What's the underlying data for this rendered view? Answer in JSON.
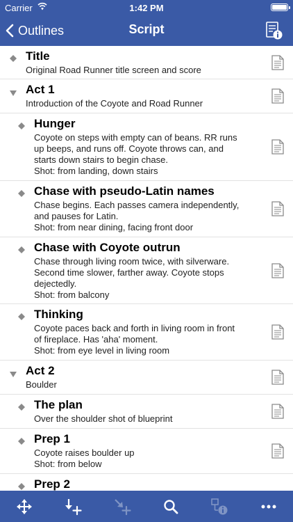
{
  "status_bar": {
    "carrier": "Carrier",
    "time": "1:42 PM"
  },
  "nav": {
    "back_label": "Outlines",
    "title": "Script"
  },
  "rows": [
    {
      "title": "Title",
      "desc": "Original Road Runner title screen and score"
    },
    {
      "title": "Act 1",
      "desc": "Introduction of the Coyote and Road Runner"
    },
    {
      "title": "Hunger",
      "desc": "Coyote on steps with empty can of beans. RR runs\nup beeps, and runs off. Coyote throws can, and\nstarts down stairs to begin chase.\nShot: from landing, down stairs"
    },
    {
      "title": "Chase with pseudo-Latin names",
      "desc": "Chase begins. Each passes camera independently,\nand pauses for Latin.\nShot: from near dining, facing front door"
    },
    {
      "title": "Chase with Coyote outrun",
      "desc": "Chase through living room twice, with silverware.\nSecond time slower, farther away. Coyote stops\ndejectedly.\nShot: from balcony"
    },
    {
      "title": "Thinking",
      "desc": "Coyote paces back and forth in living room in front\nof fireplace. Has 'aha' moment.\nShot: from eye level in living room"
    },
    {
      "title": "Act 2",
      "desc": "Boulder"
    },
    {
      "title": "The plan",
      "desc": "Over the shoulder shot of blueprint"
    },
    {
      "title": "Prep 1",
      "desc": "Coyote raises boulder up\nShot: from below"
    },
    {
      "title": "Prep 2",
      "desc": ""
    }
  ],
  "toolbar": {
    "icons": [
      "move-icon",
      "add-child-icon",
      "demote-icon",
      "search-icon",
      "info-icon",
      "more-icon"
    ]
  },
  "colors": {
    "accent": "#3a5aa6",
    "marker": "#8a8a8a",
    "separator": "#e2e2e2",
    "disabled_icon": "#7f94c4"
  }
}
